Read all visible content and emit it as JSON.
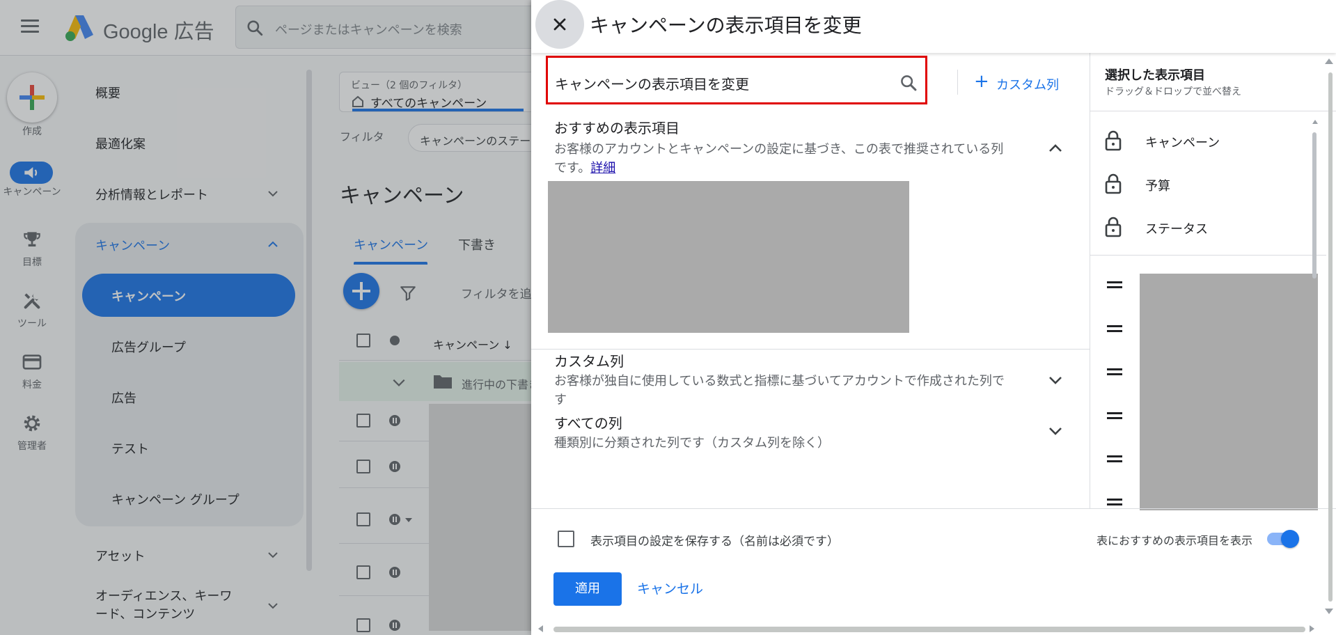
{
  "app": {
    "brand": "Google 広告",
    "search_placeholder": "ページまたはキャンペーンを検索"
  },
  "rail": {
    "create": "作成",
    "campaigns": "キャンペーン",
    "goals": "目標",
    "tools": "ツール",
    "billing": "料金",
    "admin": "管理者"
  },
  "nav": {
    "overview": "概要",
    "recommendations": "最適化案",
    "insights": "分析情報とレポート",
    "campaigns_group": "キャンペーン",
    "campaigns": "キャンペーン",
    "ad_groups": "広告グループ",
    "ads": "広告",
    "experiments": "テスト",
    "campaign_groups": "キャンペーン グループ",
    "assets": "アセット",
    "audiences": "オーディエンス、キーワード、コンテンツ"
  },
  "main": {
    "view_label": "ビュー（2 個のフィルタ）",
    "view_value": "すべてのキャンペーン",
    "filter_label": "フィルタ",
    "filter_chip": "キャンペーンのステー",
    "heading": "キャンペーン",
    "tabs": [
      "キャンペーン",
      "下書き"
    ],
    "add_filter": "フィルタを追",
    "column_campaign": "キャンペーン",
    "draft_row": "進行中の下書き"
  },
  "dialog": {
    "title": "キャンペーンの表示項目を変更",
    "search_value": "キャンペーンの表示項目を変更",
    "custom_column_button": "カスタム列",
    "sections": [
      {
        "title": "おすすめの表示項目",
        "desc": "お客様のアカウントとキャンペーンの設定に基づき、この表で推奨されている列です。",
        "link": "詳細",
        "expanded": true
      },
      {
        "title": "カスタム列",
        "desc": "お客様が独自に使用している数式と指標に基づいてアカウントで作成された列です",
        "expanded": false
      },
      {
        "title": "すべての列",
        "desc": "種類別に分類された列です（カスタム列を除く）",
        "expanded": false
      }
    ],
    "selected_panel": {
      "title": "選択した表示項目",
      "subtitle": "ドラッグ＆ドロップで並べ替え",
      "locked": [
        "キャンペーン",
        "予算",
        "ステータス"
      ]
    },
    "save_checkbox_label": "表示項目の設定を保存する（名前は必須です）",
    "save_checked": false,
    "toggle_label": "表におすすめの表示項目を表示",
    "toggle_on": true,
    "apply": "適用",
    "cancel": "キャンセル"
  },
  "colors": {
    "accent": "#1a73e8",
    "highlight_border": "#e00000",
    "redacted": "#aaaaaa"
  }
}
